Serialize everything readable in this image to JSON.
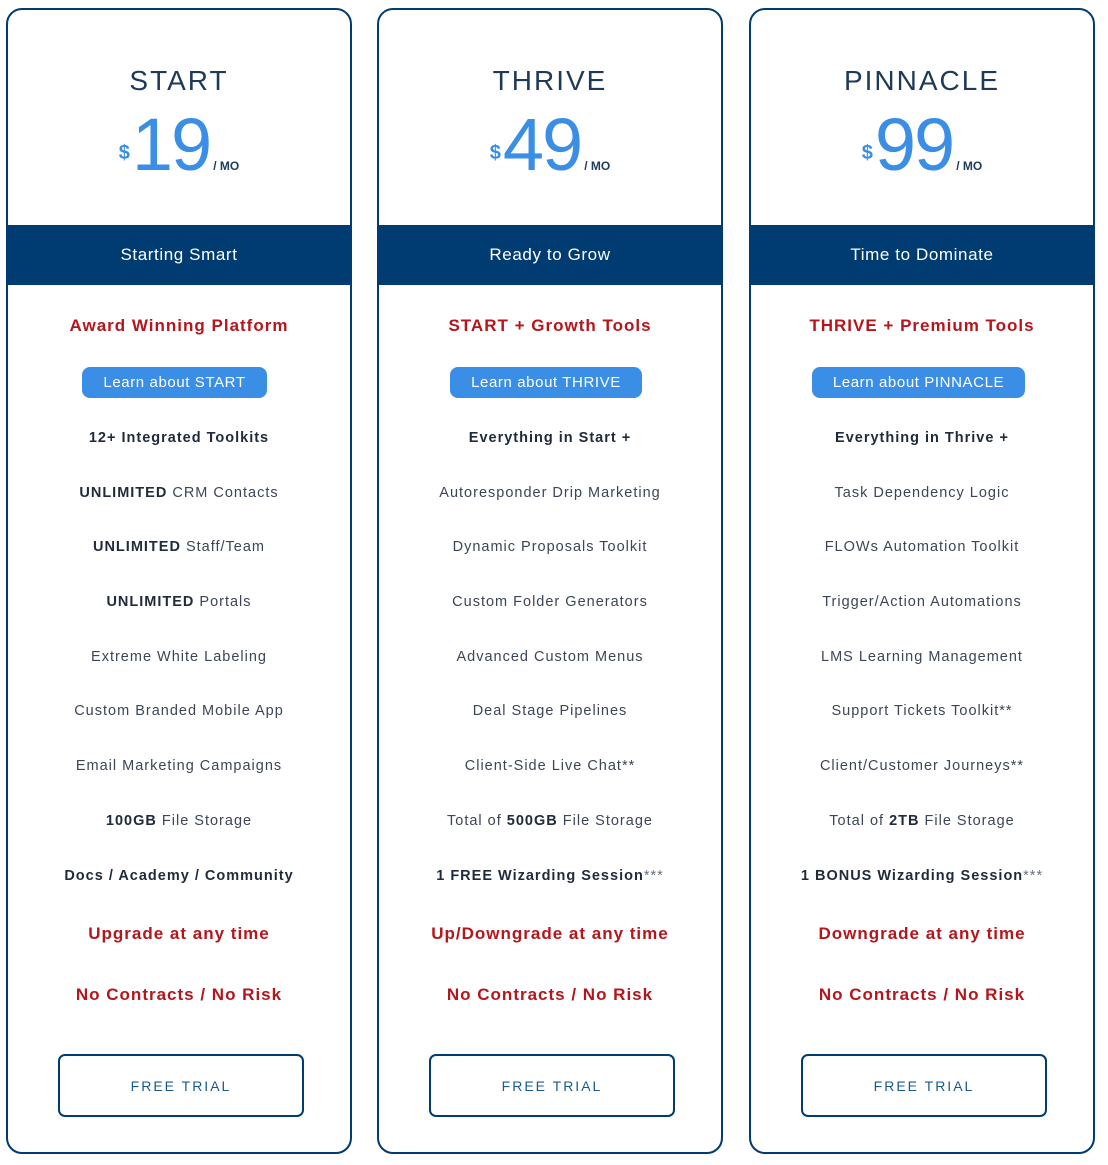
{
  "colors": {
    "navy": "#003c71",
    "accent_blue": "#3a8ee6",
    "red": "#b5151b",
    "text_dark": "#1e3a5a"
  },
  "plans": [
    {
      "name": "START",
      "price": {
        "currency": "$",
        "amount": "19",
        "period": "/ MO"
      },
      "tagline": "Starting Smart",
      "headline": "Award Winning Platform",
      "learn_label": "Learn about START",
      "features": [
        {
          "bold": "12+ Integrated Toolkits",
          "text": "",
          "suffix": "",
          "all_bold": true
        },
        {
          "bold": "UNLIMITED",
          "text": " CRM Contacts",
          "suffix": ""
        },
        {
          "bold": "UNLIMITED",
          "text": " Staff/Team",
          "suffix": ""
        },
        {
          "bold": "UNLIMITED",
          "text": " Portals",
          "suffix": ""
        },
        {
          "bold": "",
          "text": "Extreme White Labeling",
          "suffix": ""
        },
        {
          "bold": "",
          "text": "Custom Branded Mobile App",
          "suffix": ""
        },
        {
          "bold": "",
          "text": "Email Marketing Campaigns",
          "suffix": ""
        },
        {
          "bold": "100GB",
          "text": " File Storage",
          "suffix": ""
        },
        {
          "bold": "Docs / Academy / Community",
          "text": "",
          "suffix": "",
          "all_bold": true
        }
      ],
      "notes": [
        "Upgrade at any time",
        "No Contracts / No Risk"
      ],
      "cta_label": "FREE TRIAL"
    },
    {
      "name": "THRIVE",
      "price": {
        "currency": "$",
        "amount": "49",
        "period": "/ MO"
      },
      "tagline": "Ready to Grow",
      "headline": "START + Growth Tools",
      "learn_label": "Learn about THRIVE",
      "features": [
        {
          "bold": "Everything in Start +",
          "text": "",
          "suffix": "",
          "all_bold": true
        },
        {
          "bold": "",
          "text": "Autoresponder Drip Marketing",
          "suffix": ""
        },
        {
          "bold": "",
          "text": "Dynamic Proposals Toolkit",
          "suffix": ""
        },
        {
          "bold": "",
          "text": "Custom Folder Generators",
          "suffix": ""
        },
        {
          "bold": "",
          "text": "Advanced Custom Menus",
          "suffix": ""
        },
        {
          "bold": "",
          "text": "Deal Stage Pipelines",
          "suffix": ""
        },
        {
          "bold": "",
          "text": "Client-Side Live Chat**",
          "suffix": ""
        },
        {
          "pre": "Total of ",
          "bold": "500GB",
          "text": " File Storage",
          "suffix": ""
        },
        {
          "bold": "1 FREE Wizarding Session",
          "text": "",
          "suffix": "***",
          "all_bold": true
        }
      ],
      "notes": [
        "Up/Downgrade at any time",
        "No Contracts / No Risk"
      ],
      "cta_label": "FREE TRIAL"
    },
    {
      "name": "PINNACLE",
      "price": {
        "currency": "$",
        "amount": "99",
        "period": "/ MO"
      },
      "tagline": "Time to Dominate",
      "headline": "THRIVE + Premium Tools",
      "learn_label": "Learn about PINNACLE",
      "features": [
        {
          "bold": "Everything in Thrive +",
          "text": "",
          "suffix": "",
          "all_bold": true
        },
        {
          "bold": "",
          "text": "Task Dependency Logic",
          "suffix": ""
        },
        {
          "bold": "",
          "text": "FLOWs Automation Toolkit",
          "suffix": ""
        },
        {
          "bold": "",
          "text": "Trigger/Action Automations",
          "suffix": ""
        },
        {
          "bold": "",
          "text": "LMS Learning Management",
          "suffix": ""
        },
        {
          "bold": "",
          "text": "Support Tickets Toolkit**",
          "suffix": ""
        },
        {
          "bold": "",
          "text": "Client/Customer Journeys**",
          "suffix": ""
        },
        {
          "pre": "Total of ",
          "bold": "2TB",
          "text": " File Storage",
          "suffix": ""
        },
        {
          "bold": "1 BONUS Wizarding Session",
          "text": "",
          "suffix": "***",
          "all_bold": true
        }
      ],
      "notes": [
        "Downgrade at any time",
        "No Contracts / No Risk"
      ],
      "cta_label": "FREE TRIAL"
    }
  ]
}
